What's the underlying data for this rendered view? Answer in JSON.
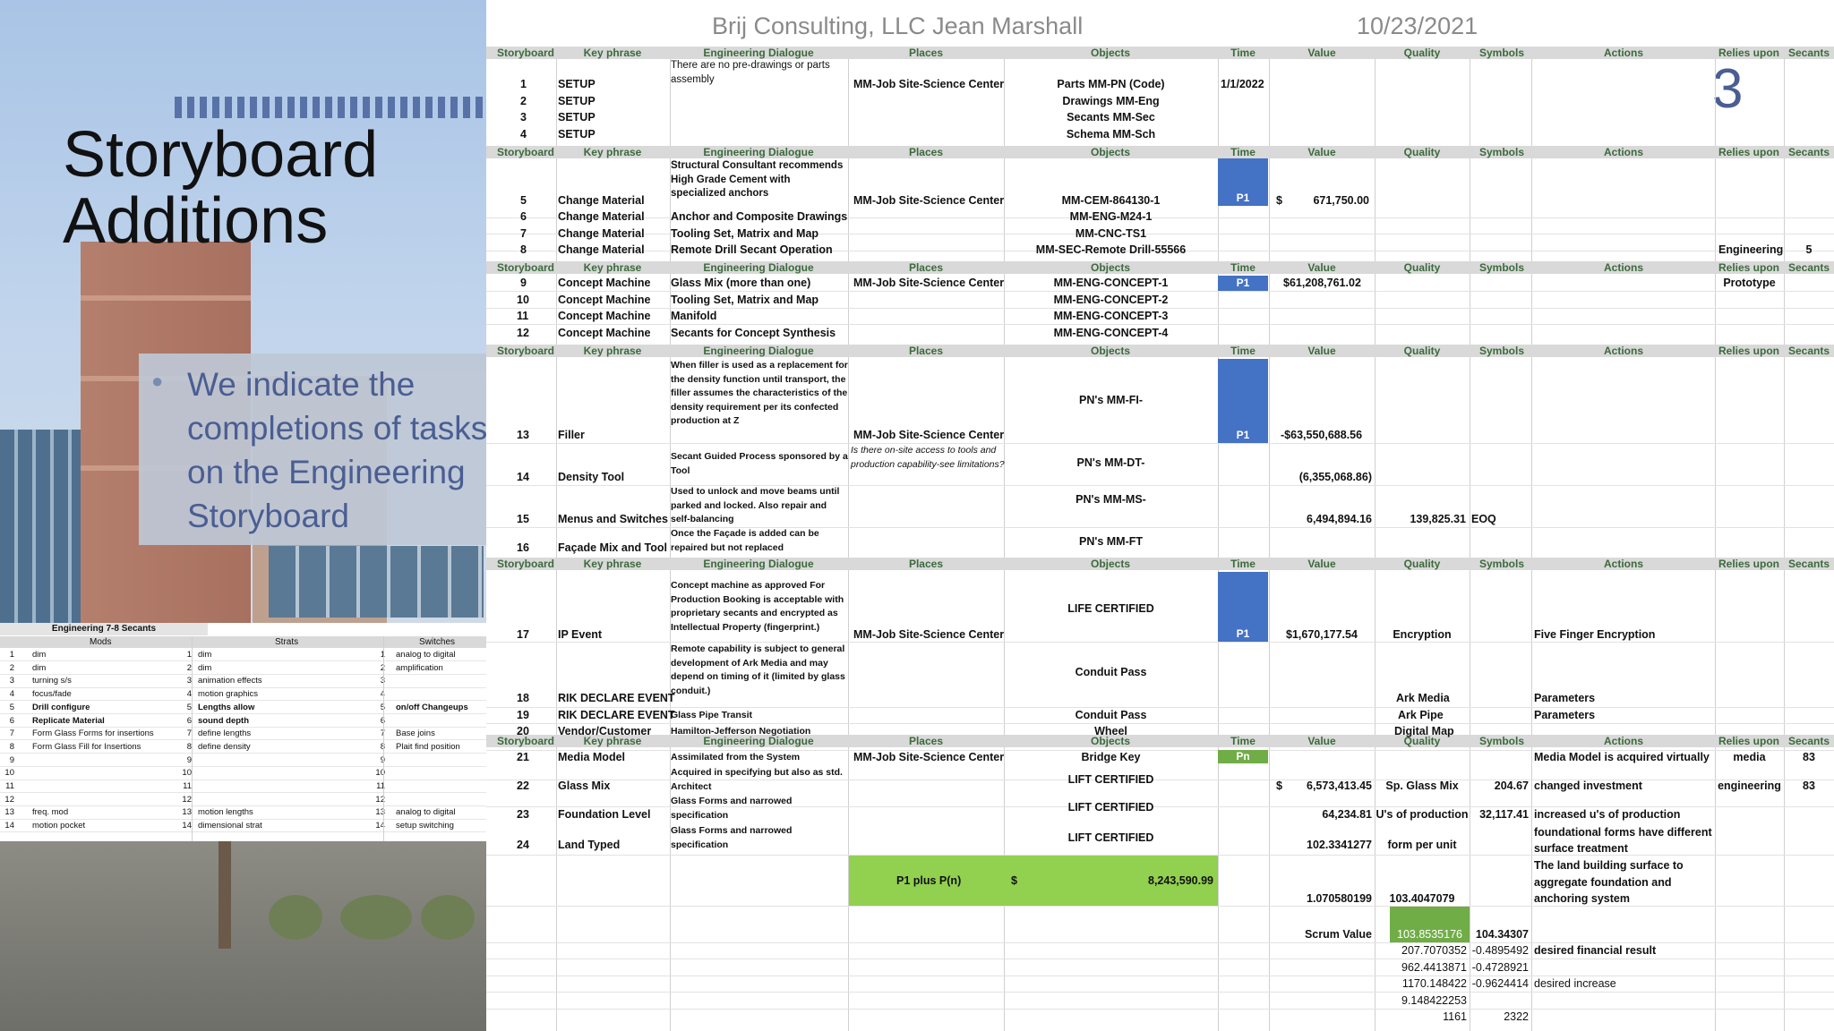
{
  "slide": {
    "title_line1": "Storyboard",
    "title_line2": "Additions",
    "bullet": "We indicate the completions of tasks on the Engineering Storyboard",
    "header_left": "Brij Consulting, LLC Jean Marshall",
    "header_date": "10/23/2021",
    "slide_number": "3"
  },
  "mini_table": {
    "title": "Engineering 7-8 Secants",
    "headers": [
      "Mods",
      "Strats",
      "Switches"
    ],
    "rows": [
      [
        "1",
        "dim",
        "1",
        "dim",
        "1",
        "analog to digital"
      ],
      [
        "2",
        "dim",
        "2",
        "dim",
        "2",
        "amplification"
      ],
      [
        "3",
        "turning s/s",
        "3",
        "animation effects",
        "3",
        ""
      ],
      [
        "4",
        "focus/fade",
        "4",
        "motion graphics",
        "4",
        ""
      ],
      [
        "5",
        "Drill configure",
        "5",
        "Lengths allow",
        "5",
        "on/off Changeups"
      ],
      [
        "6",
        "Replicate Material",
        "6",
        "sound depth",
        "6",
        ""
      ],
      [
        "7",
        "Form Glass Forms for insertions",
        "7",
        "define lengths",
        "7",
        "Base joins"
      ],
      [
        "8",
        "Form Glass Fill for Insertions",
        "8",
        "define density",
        "8",
        "Plait find position"
      ],
      [
        "9",
        "",
        "9",
        "",
        "9",
        ""
      ],
      [
        "10",
        "",
        "10",
        "",
        "10",
        ""
      ],
      [
        "11",
        "",
        "11",
        "",
        "11",
        ""
      ],
      [
        "12",
        "",
        "12",
        "",
        "12",
        ""
      ],
      [
        "13",
        "freq. mod",
        "13",
        "motion lengths",
        "13",
        "analog to digital"
      ],
      [
        "14",
        "motion pocket",
        "14",
        "dimensional strat",
        "14",
        "setup switching"
      ]
    ]
  },
  "columns": [
    "Storyboard",
    "Key phrase",
    "Engineering Dialogue",
    "Places",
    "Objects",
    "Time",
    "Value",
    "Quality",
    "Symbols",
    "Actions",
    "Relies upon",
    "Secants"
  ],
  "cells": {
    "r1_key": "SETUP",
    "r2_key": "SETUP",
    "r3_key": "SETUP",
    "r4_key": "SETUP",
    "r1_dlg": "There are no pre-drawings or parts assembly",
    "r1_place": "MM-Job Site-Science Center",
    "r1_obj": "Parts MM-PN (Code)",
    "r2_obj": "Drawings MM-Eng",
    "r3_obj": "Secants MM-Sec",
    "r4_obj": "Schema MM-Sch",
    "r1_time": "1/1/2022",
    "r5_key": "Change Material",
    "r6_key": "Change Material",
    "r7_key": "Change Material",
    "r8_key": "Change Material",
    "r5_dlg": "Structural Consultant recommends High Grade Cement with specialized anchors",
    "r6_dlg": "Anchor and Composite Drawings",
    "r7_dlg": "Tooling Set, Matrix and Map",
    "r8_dlg": "Remote Drill Secant Operation",
    "r5_place": "MM-Job Site-Science Center",
    "r5_obj": "MM-CEM-864130-1",
    "r6_obj": "MM-ENG-M24-1",
    "r7_obj": "MM-CNC-TS1",
    "r8_obj": "MM-SEC-Remote Drill-55566",
    "r5_time": "P1",
    "r5_cur": "$",
    "r5_val": "671,750.00",
    "r8_relies": "Engineering",
    "r8_secants": "5",
    "r9_key": "Concept Machine",
    "r10_key": "Concept Machine",
    "r11_key": "Concept Machine",
    "r12_key": "Concept Machine",
    "r9_dlg": "Glass Mix (more than one)",
    "r10_dlg": "Tooling Set, Matrix and Map",
    "r11_dlg": "Manifold",
    "r12_dlg": "Secants for Concept Synthesis",
    "r9_place": "MM-Job Site-Science Center",
    "r9_obj": "MM-ENG-CONCEPT-1",
    "r10_obj": "MM-ENG-CONCEPT-2",
    "r11_obj": "MM-ENG-CONCEPT-3",
    "r12_obj": "MM-ENG-CONCEPT-4",
    "r9_time": "P1",
    "r9_val": "$61,208,761.02",
    "r9_relies": "Prototype",
    "r13_key": "Filler",
    "r14_key": "Density Tool",
    "r15_key": "Menus and Switches",
    "r16_key": "Façade Mix and Tool",
    "r13_dlg": "When filler is used as a replacement for the density function until transport, the filler assumes the characteristics of the density requirement per its confected production at Z",
    "r14_dlg": "Secant Guided Process sponsored by a Tool",
    "r15_dlg": "Used to unlock and move beams until parked and locked. Also repair and self-balancing",
    "r16_dlg": "Once the Façade is added can be repaired but not replaced",
    "r13_place": "MM-Job Site-Science Center",
    "r14_place": "Is there on-site access to tools and production capability-see limitations?",
    "r13_obj": "PN's MM-FI-",
    "r14_obj": "PN's MM-DT-",
    "r15_obj": "PN's MM-MS-",
    "r16_obj": "PN's MM-FT",
    "r13_time": "P1",
    "r13_val": "-$63,550,688.56",
    "r14_val": "(6,355,068.86)",
    "r15_val": "6,494,894.16",
    "r15_quality": "139,825.31",
    "r15_symbols": "EOQ",
    "r17_key": "IP Event",
    "r18_key": "RIK DECLARE EVENT",
    "r19_key": "RIK DECLARE EVENT",
    "r20_key": "Vendor/Customer",
    "r17_dlg": "Concept machine as approved For Production Booking is acceptable with proprietary secants and encrypted as Intellectual Property (fingerprint.)",
    "r18_dlg": "Remote capability is subject to general development of Ark Media and may depend on timing of it (limited by glass conduit.)",
    "r19_dlg": "Glass Pipe Transit",
    "r20_dlg": "Hamilton-Jefferson Negotiation",
    "r17_place": "MM-Job Site-Science Center",
    "r17_obj": "LIFE CERTIFIED",
    "r18_obj": "Conduit Pass",
    "r19_obj": "Conduit Pass",
    "r20_obj": "Wheel",
    "r17_time": "P1",
    "r17_val": "$1,670,177.54",
    "r17_quality": "Encryption",
    "r18_quality": "Ark Media",
    "r19_quality": "Ark Pipe",
    "r20_quality": "Digital Map",
    "r17_actions": "Five Finger Encryption",
    "r18_actions": "Parameters",
    "r19_actions": "Parameters",
    "r21_key": "Media Model",
    "r22_key": "Glass Mix",
    "r23_key": "Foundation Level",
    "r24_key": "Land Typed",
    "r21_dlg": "Assimilated from the System",
    "r22_dlg": "Acquired in specifying but also as std. Architect",
    "r23_dlg": "Glass Forms and narrowed specification",
    "r24_dlg": "Glass Forms and narrowed specification",
    "r21_place": "MM-Job Site-Science Center",
    "r21_obj": "Bridge Key",
    "r22_obj": "LIFT CERTIFIED",
    "r23_obj": "LIFT CERTIFIED",
    "r24_obj": "LIFT CERTIFIED",
    "r21_time": "Pn",
    "r22_cur": "$",
    "r22_val": "6,573,413.45",
    "r23_val": "64,234.81",
    "r24_val": "102.3341277",
    "r22_quality": "Sp. Glass Mix",
    "r23_quality": "U's of production",
    "r24_quality": "form per unit",
    "r22_symbols": "204.67",
    "r23_symbols": "32,117.41",
    "r21_actions": "Media Model is acquired virtually",
    "r22_actions": "changed investment",
    "r23_actions": "increased u's of production",
    "r24_actions": "foundational forms have different surface treatment",
    "r25_actions": "The land building surface to aggregate foundation and anchoring system",
    "r21_relies": "media",
    "r21_secants": "83",
    "r22_relies": "engineering",
    "r22_secants": "83",
    "total_label": "P1 plus P(n)",
    "total_cur": "$",
    "total_val": "8,243,590.99",
    "r25_val": "1.070580199",
    "r25_quality": "103.4047079",
    "scrum_label": "Scrum Value",
    "scrum_quality": "103.8535176",
    "scrum_symbols": "104.34307",
    "ex1_val": "207.7070352",
    "ex1_sym": "-0.4895492",
    "ex1_act": "desired financial result",
    "ex2_val": "962.4413871",
    "ex2_sym": "-0.4728921",
    "ex3_val": "1170.148422",
    "ex3_sym": "-0.9624414",
    "ex3_act": "desired increase",
    "ex4_val": "9.148422253",
    "ex5_val": "1161",
    "ex5_sym": "2322"
  },
  "colors": {
    "time_fill": "#4472c4",
    "total_fill": "#92d050",
    "scrum_fill": "#70ad47",
    "header_fill": "#d9d9d9",
    "header_text": "#3c6a3c",
    "accent": "#4a5e93"
  }
}
